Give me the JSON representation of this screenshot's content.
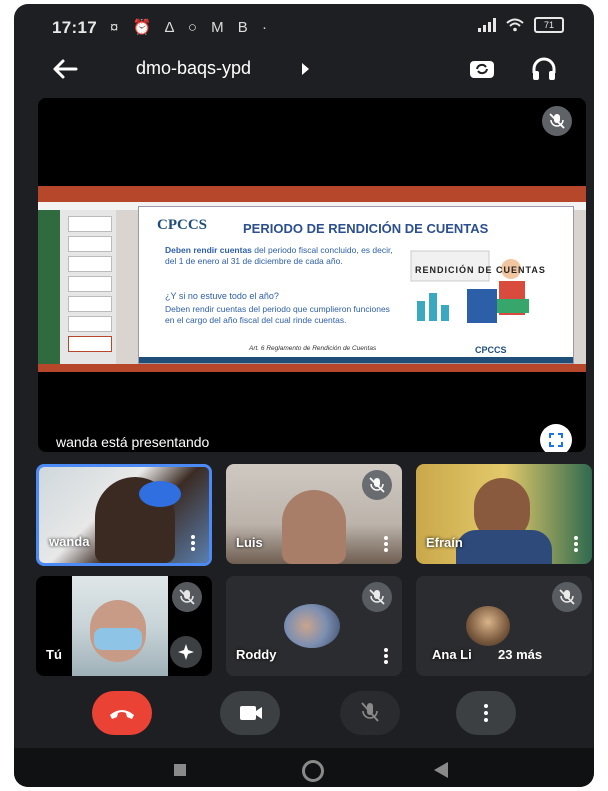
{
  "status_bar": {
    "time": "17:17",
    "notification_icons": "¤ ⏰ Δ ○ M B ·",
    "battery": "71"
  },
  "header": {
    "meeting_code": "dmo-baqs-ypd"
  },
  "presentation": {
    "presenting_text": "wanda está presentando",
    "slide": {
      "logo": "CPCCS",
      "title": "PERIODO DE RENDICIÓN DE CUENTAS",
      "para1_bold": "Deben rendir cuentas",
      "para1_rest": " del periodo fiscal concluido, es decir, del 1 de enero al 31 de diciembre de cada año.",
      "question": "¿Y si no estuve todo el año?",
      "para2": "Deben rendir cuentas del periodo que cumplieron funciones en el cargo del año fiscal del cual rinde cuentas.",
      "art_title": "RENDICIÓN DE CUENTAS",
      "footer": "Art. 6 Reglamento de Rendición de Cuentas",
      "footer_logo": "CPCCS"
    }
  },
  "participants": [
    {
      "name": "wanda",
      "muted": false,
      "active": true
    },
    {
      "name": "Luis",
      "muted": true
    },
    {
      "name": "Efraín",
      "muted": false
    },
    {
      "name": "Tú",
      "muted": true
    },
    {
      "name": "Roddy",
      "muted": true
    },
    {
      "name": "Ana Li",
      "muted": true,
      "more_label": "23 más"
    }
  ],
  "colors": {
    "background": "#1e1f22",
    "end_call": "#ea4335",
    "active_border": "#4c8bf5",
    "slide_blue": "#2c4f8f"
  }
}
